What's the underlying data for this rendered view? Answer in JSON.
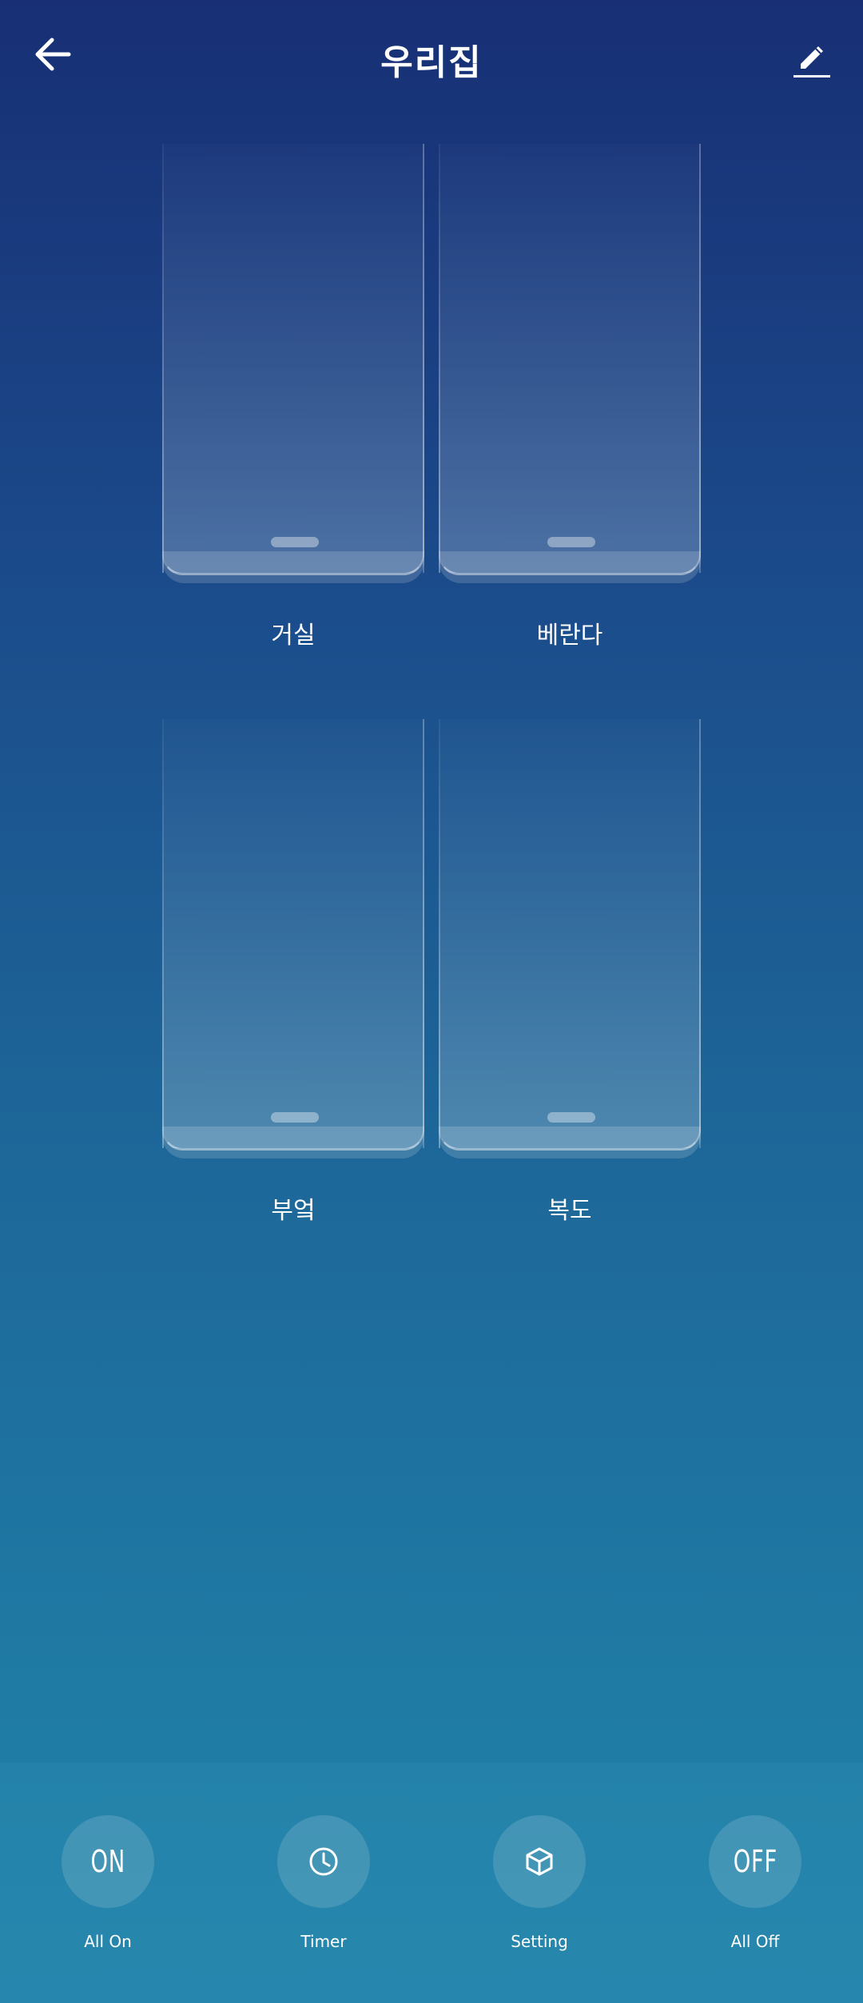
{
  "header": {
    "title": "우리집"
  },
  "icons": {
    "back": "arrow-left-icon",
    "edit": "pencil-icon",
    "timer": "clock-icon",
    "setting": "cube-icon"
  },
  "switches": [
    {
      "label": "거실"
    },
    {
      "label": "베란다"
    },
    {
      "label": "부엌"
    },
    {
      "label": "복도"
    }
  ],
  "actions": [
    {
      "icon_text": "ON",
      "label": "All On"
    },
    {
      "label": "Timer"
    },
    {
      "label": "Setting"
    },
    {
      "icon_text": "OFF",
      "label": "All Off"
    }
  ],
  "colors": {
    "background_top": "#182f75",
    "background_bottom": "#2181a8",
    "text": "#ffffff"
  }
}
